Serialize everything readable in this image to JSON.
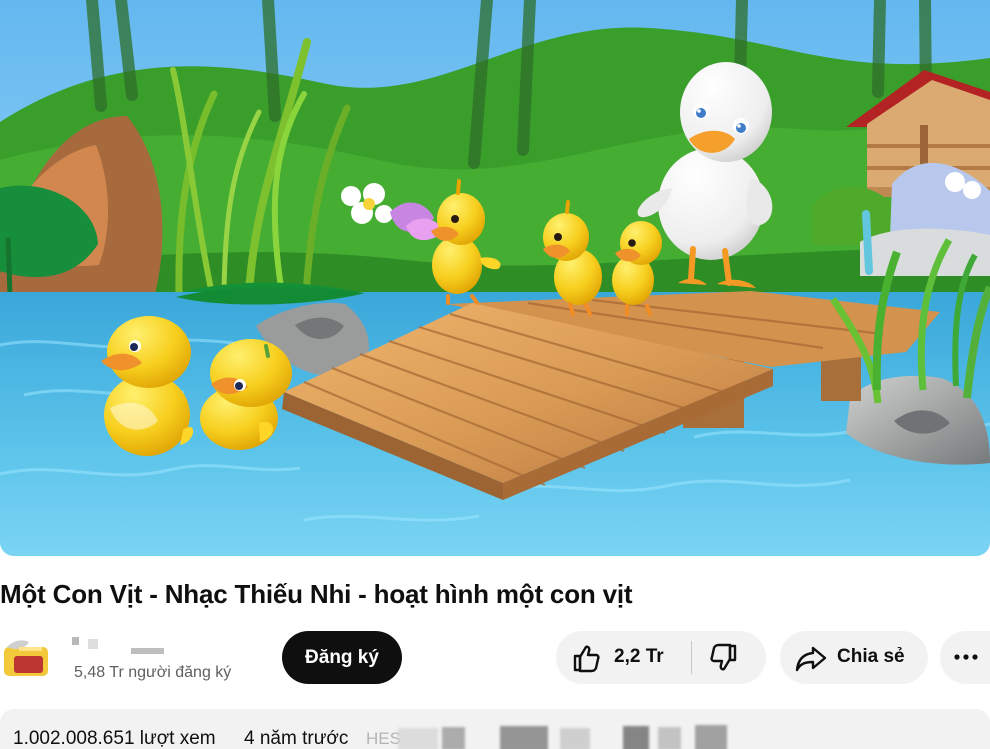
{
  "video": {
    "title": "Một Con Vịt - Nhạc Thiếu Nhi - hoạt hình một con vịt",
    "thumbnail_subject": "cartoon-white-duck-and-yellow-ducklings-on-wooden-bridge",
    "colors": {
      "sky": "#76c1ef",
      "grass": "#42aa32",
      "water": "#4bb6df",
      "wood": "#d99a55",
      "duckling": "#f4c51f",
      "beak": "#f19a28"
    }
  },
  "channel": {
    "avatar_icon": "channel-avatar-icon",
    "subscribers": "5,48 Tr người đăng ký"
  },
  "actions": {
    "subscribe": "Đăng ký",
    "like_count": "2,2 Tr",
    "share": "Chia sẻ",
    "like_icon": "thumbs-up-icon",
    "dislike_icon": "thumbs-down-icon",
    "share_icon": "share-arrow-icon",
    "more_icon": "more-horizontal-icon"
  },
  "description": {
    "views": "1.002.008.651 lượt xem",
    "age": "4 năm trước",
    "hashtag_fragment": "HES"
  }
}
